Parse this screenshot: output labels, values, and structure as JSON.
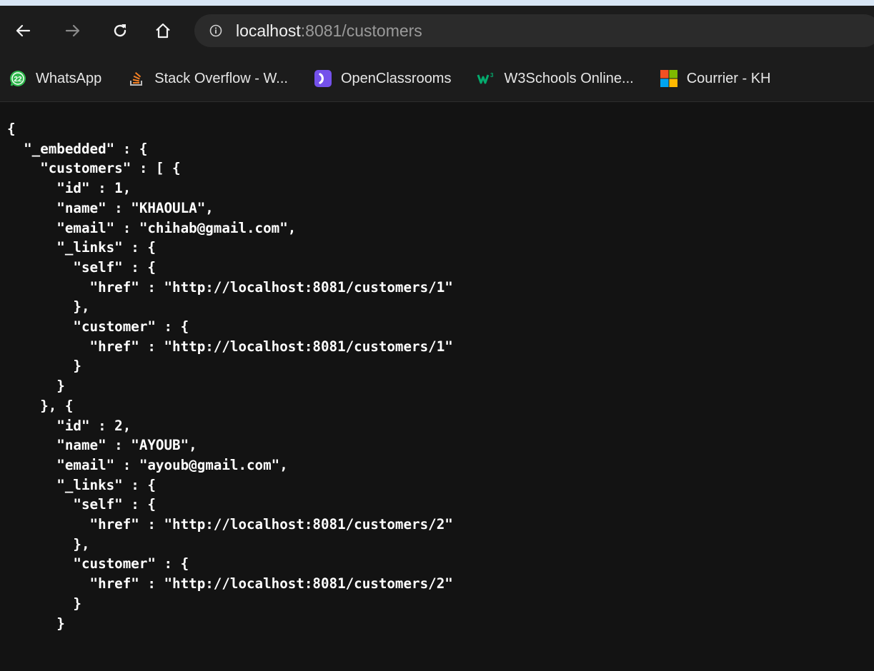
{
  "toolbar": {
    "back_icon": "back-arrow-icon",
    "forward_icon": "forward-arrow-icon",
    "reload_icon": "reload-icon",
    "home_icon": "home-icon",
    "info_icon": "info-icon",
    "url_host": "localhost",
    "url_rest": ":8081/customers"
  },
  "bookmarks": [
    {
      "label": "WhatsApp",
      "icon": "whatsapp-icon",
      "badge": "22"
    },
    {
      "label": "Stack Overflow - W...",
      "icon": "stackoverflow-icon"
    },
    {
      "label": "OpenClassrooms",
      "icon": "openclassrooms-icon"
    },
    {
      "label": "W3Schools Online...",
      "icon": "w3schools-icon"
    },
    {
      "label": "Courrier - KH",
      "icon": "microsoft-icon"
    }
  ],
  "content": {
    "json_text": "{\n  \"_embedded\" : {\n    \"customers\" : [ {\n      \"id\" : 1,\n      \"name\" : \"KHAOULA\",\n      \"email\" : \"chihab@gmail.com\",\n      \"_links\" : {\n        \"self\" : {\n          \"href\" : \"http://localhost:8081/customers/1\"\n        },\n        \"customer\" : {\n          \"href\" : \"http://localhost:8081/customers/1\"\n        }\n      }\n    }, {\n      \"id\" : 2,\n      \"name\" : \"AYOUB\",\n      \"email\" : \"ayoub@gmail.com\",\n      \"_links\" : {\n        \"self\" : {\n          \"href\" : \"http://localhost:8081/customers/2\"\n        },\n        \"customer\" : {\n          \"href\" : \"http://localhost:8081/customers/2\"\n        }\n      }"
  },
  "colors": {
    "page_bg": "#d8e6f5",
    "toolbar_bg": "#1c1c1c",
    "omnibox_bg": "#2b2b2b",
    "content_bg": "#131313",
    "text": "#ffffff"
  }
}
